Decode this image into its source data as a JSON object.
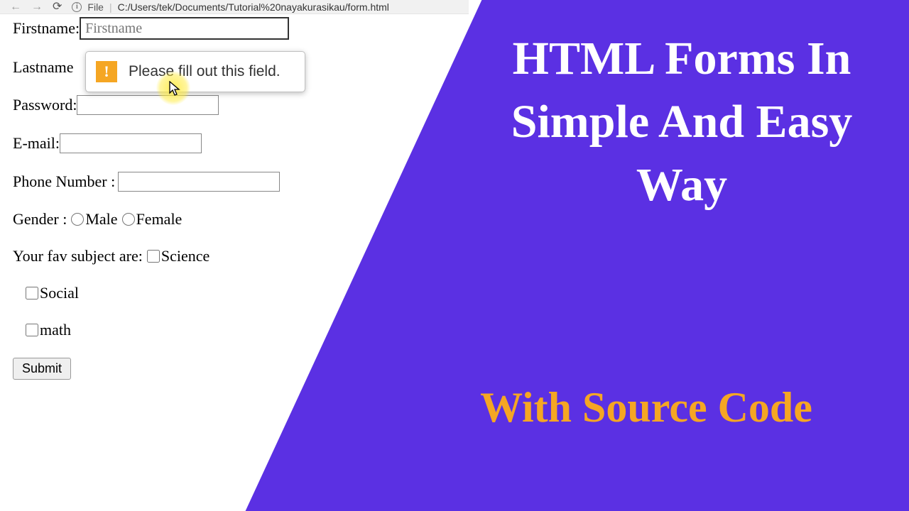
{
  "chrome": {
    "file_label": "File",
    "path": "C:/Users/tek/Documents/Tutorial%20nayakurasikau/form.html"
  },
  "form": {
    "firstname_label": "Firstname:",
    "firstname_placeholder": "Firstname",
    "lastname_label": "Lastname",
    "password_label": "Password:",
    "email_label": "E-mail:",
    "phone_label": "Phone Number :",
    "gender_label": "Gender :",
    "gender_male": "Male",
    "gender_female": "Female",
    "fav_label": "Your fav subject are:",
    "subj_science": "Science",
    "subj_social": "Social",
    "subj_math": "math",
    "submit": "Submit"
  },
  "tooltip": {
    "message": "Please fill out this field."
  },
  "promo": {
    "headline": "HTML Forms In Simple And Easy Way",
    "subline": "With Source Code"
  }
}
